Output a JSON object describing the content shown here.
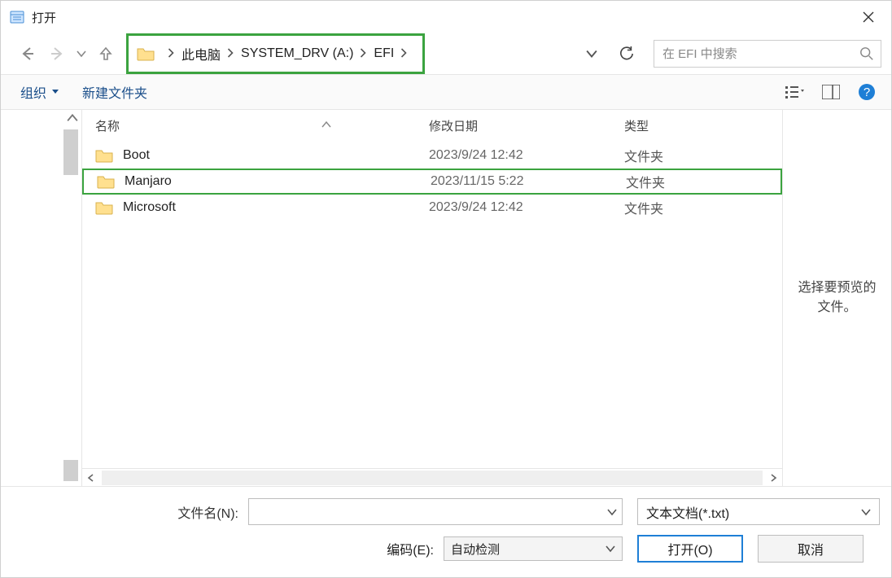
{
  "window": {
    "title": "打开"
  },
  "nav": {
    "breadcrumb": [
      "此电脑",
      "SYSTEM_DRV (A:)",
      "EFI"
    ],
    "search_placeholder": "在 EFI 中搜索"
  },
  "toolbar": {
    "organize": "组织",
    "new_folder": "新建文件夹"
  },
  "columns": {
    "name": "名称",
    "date": "修改日期",
    "type": "类型"
  },
  "rows": [
    {
      "name": "Boot",
      "date": "2023/9/24 12:42",
      "type": "文件夹",
      "hl": false
    },
    {
      "name": "Manjaro",
      "date": "2023/11/15 5:22",
      "type": "文件夹",
      "hl": true
    },
    {
      "name": "Microsoft",
      "date": "2023/9/24 12:42",
      "type": "文件夹",
      "hl": false
    }
  ],
  "preview": {
    "text": "选择要预览的文件。"
  },
  "bottom": {
    "fname_label": "文件名(N):",
    "fname_value": "",
    "filter_label": "文本文档(*.txt)",
    "encoding_label": "编码(E):",
    "encoding_value": "自动检测",
    "open": "打开(O)",
    "cancel": "取消"
  }
}
